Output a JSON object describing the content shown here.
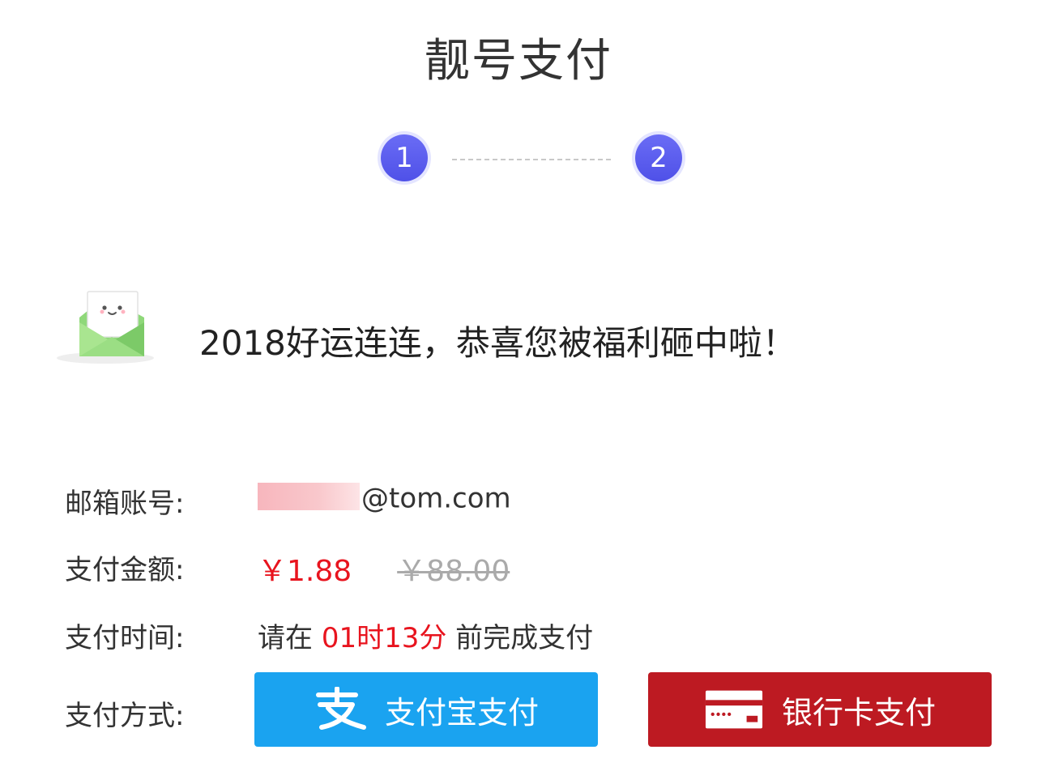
{
  "header": {
    "title": "靓号支付"
  },
  "steps": [
    {
      "number": "1"
    },
    {
      "number": "2"
    }
  ],
  "banner": {
    "text": "2018好运连连，恭喜您被福利砸中啦！"
  },
  "info": {
    "email": {
      "label": "邮箱账号:",
      "domain": "@tom.com"
    },
    "amount": {
      "label": "支付金额:",
      "current": "￥1.88",
      "original": "￥88.00"
    },
    "time": {
      "label": "支付时间:",
      "prefix": "请在",
      "countdown": "01时13分",
      "suffix": "前完成支付"
    },
    "method": {
      "label": "支付方式:",
      "alipay_label": "支付宝支付",
      "bank_label": "银行卡支付"
    }
  },
  "colors": {
    "step_accent": "#5a5cee",
    "alipay_blue": "#1aa3f0",
    "bank_red": "#bd1a22",
    "price_red": "#e8141e"
  },
  "icons": {
    "envelope": "envelope-smile-icon",
    "alipay": "alipay-icon",
    "bank_card": "bank-card-icon"
  }
}
